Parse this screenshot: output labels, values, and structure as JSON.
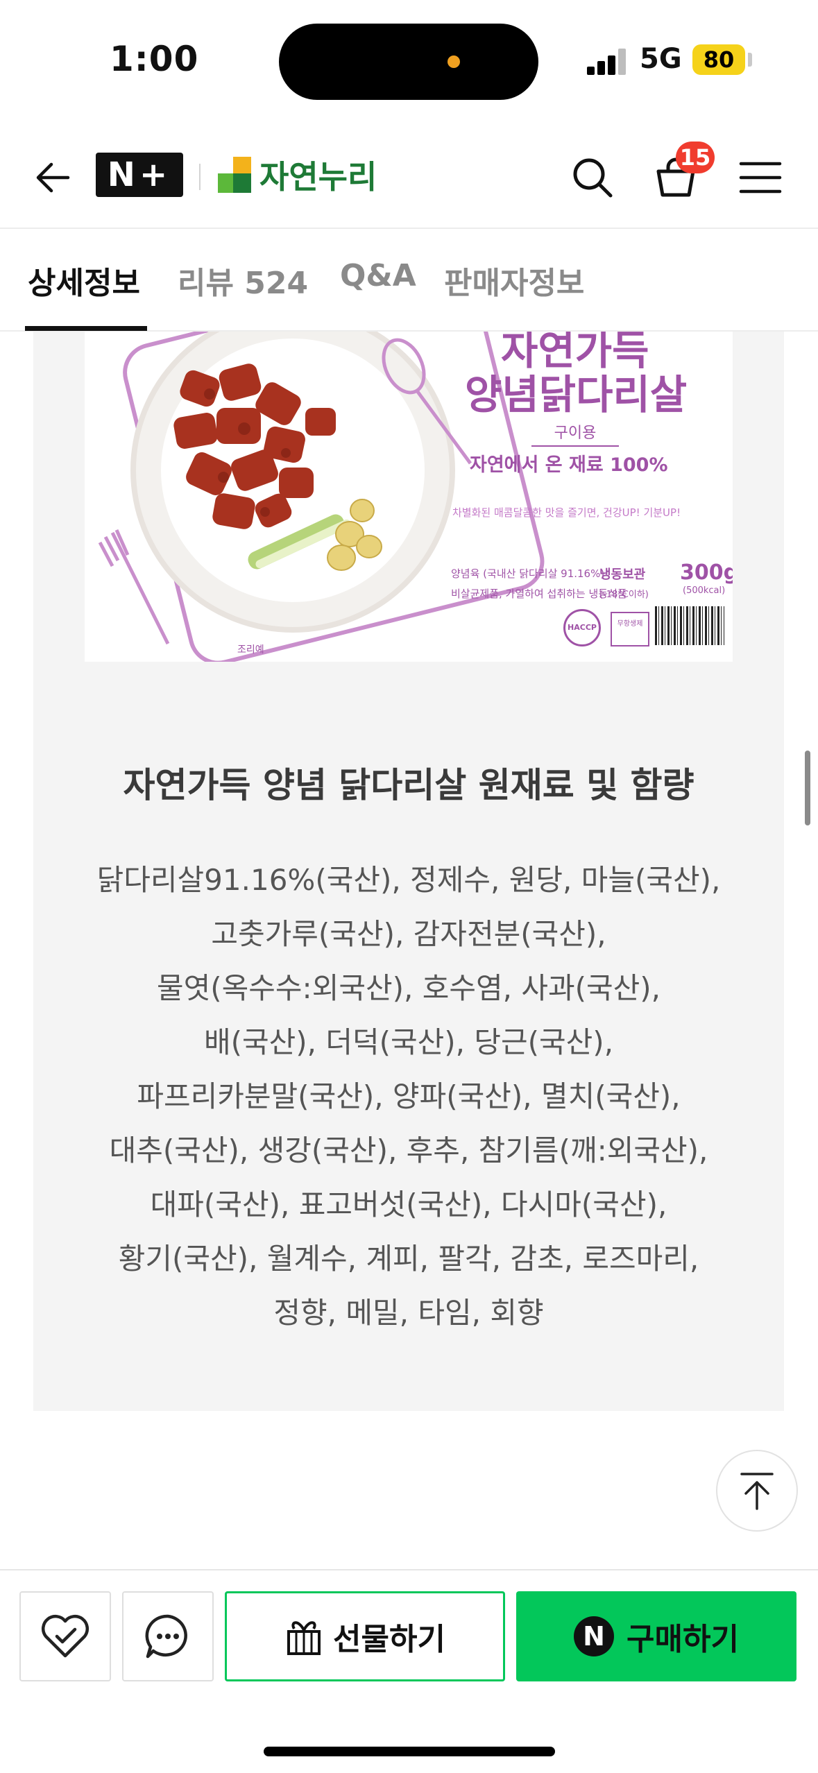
{
  "status_bar": {
    "time": "1:00",
    "network": "5G",
    "battery": "80",
    "icons": [
      "signal-bars-icon",
      "battery-icon"
    ]
  },
  "header": {
    "nplus_logo": "N+",
    "brand_name": "자연누리",
    "cart_count": "15",
    "icons": [
      "back-arrow-icon",
      "search-icon",
      "cart-icon",
      "menu-icon"
    ]
  },
  "tabs": [
    {
      "label": "상세정보",
      "active": true
    },
    {
      "label": "리뷰 524",
      "active": false
    },
    {
      "label": "Q&A",
      "active": false
    },
    {
      "label": "판매자정보",
      "active": false
    }
  ],
  "product_image": {
    "title_line1": "자연가득",
    "title_line2": "양념닭다리살",
    "subtitle": "구이용",
    "tagline": "자연에서 온 재료 100%",
    "slogan": "차별화된 매콤달콤한 맛을 즐기면, 건강UP! 기분UP!",
    "info_left": "양념육 (국내산 닭다리살 91.16%)",
    "info_left2": "비살균제품, 가열하여 섭취하는 냉동식품",
    "storage": "냉동보관",
    "storage_temp": "(-18°C이하)",
    "weight": "300g",
    "kcal": "(500kcal)",
    "haccp": "HACCP",
    "box_label": "무항생제",
    "caption": "조리예"
  },
  "content": {
    "title": "자연가득 양념 닭다리살 원재료 및 함량",
    "ingredients": [
      "닭다리살91.16%(국산), 정제수, 원당, 마늘(국산),",
      "고춧가루(국산), 감자전분(국산),",
      "물엿(옥수수:외국산), 호수염, 사과(국산),",
      "배(국산), 더덕(국산), 당근(국산),",
      "파프리카분말(국산), 양파(국산), 멸치(국산),",
      "대추(국산), 생강(국산), 후추, 참기름(깨:외국산),",
      "대파(국산), 표고버섯(국산), 다시마(국산),",
      "황기(국산), 월계수, 계피, 팔각, 감초, 로즈마리,",
      "정향, 메밀, 타임, 회향"
    ]
  },
  "bottom_bar": {
    "gift_label": "선물하기",
    "buy_label": "구매하기",
    "buy_badge": "N",
    "icons": [
      "wishlist-heart-icon",
      "chat-icon",
      "gift-icon",
      "scroll-top-icon"
    ]
  },
  "colors": {
    "accent_green": "#03c75a",
    "brand_green": "#1e7a36",
    "badge_red": "#f03c2e",
    "package_purple": "#9f52a6"
  }
}
